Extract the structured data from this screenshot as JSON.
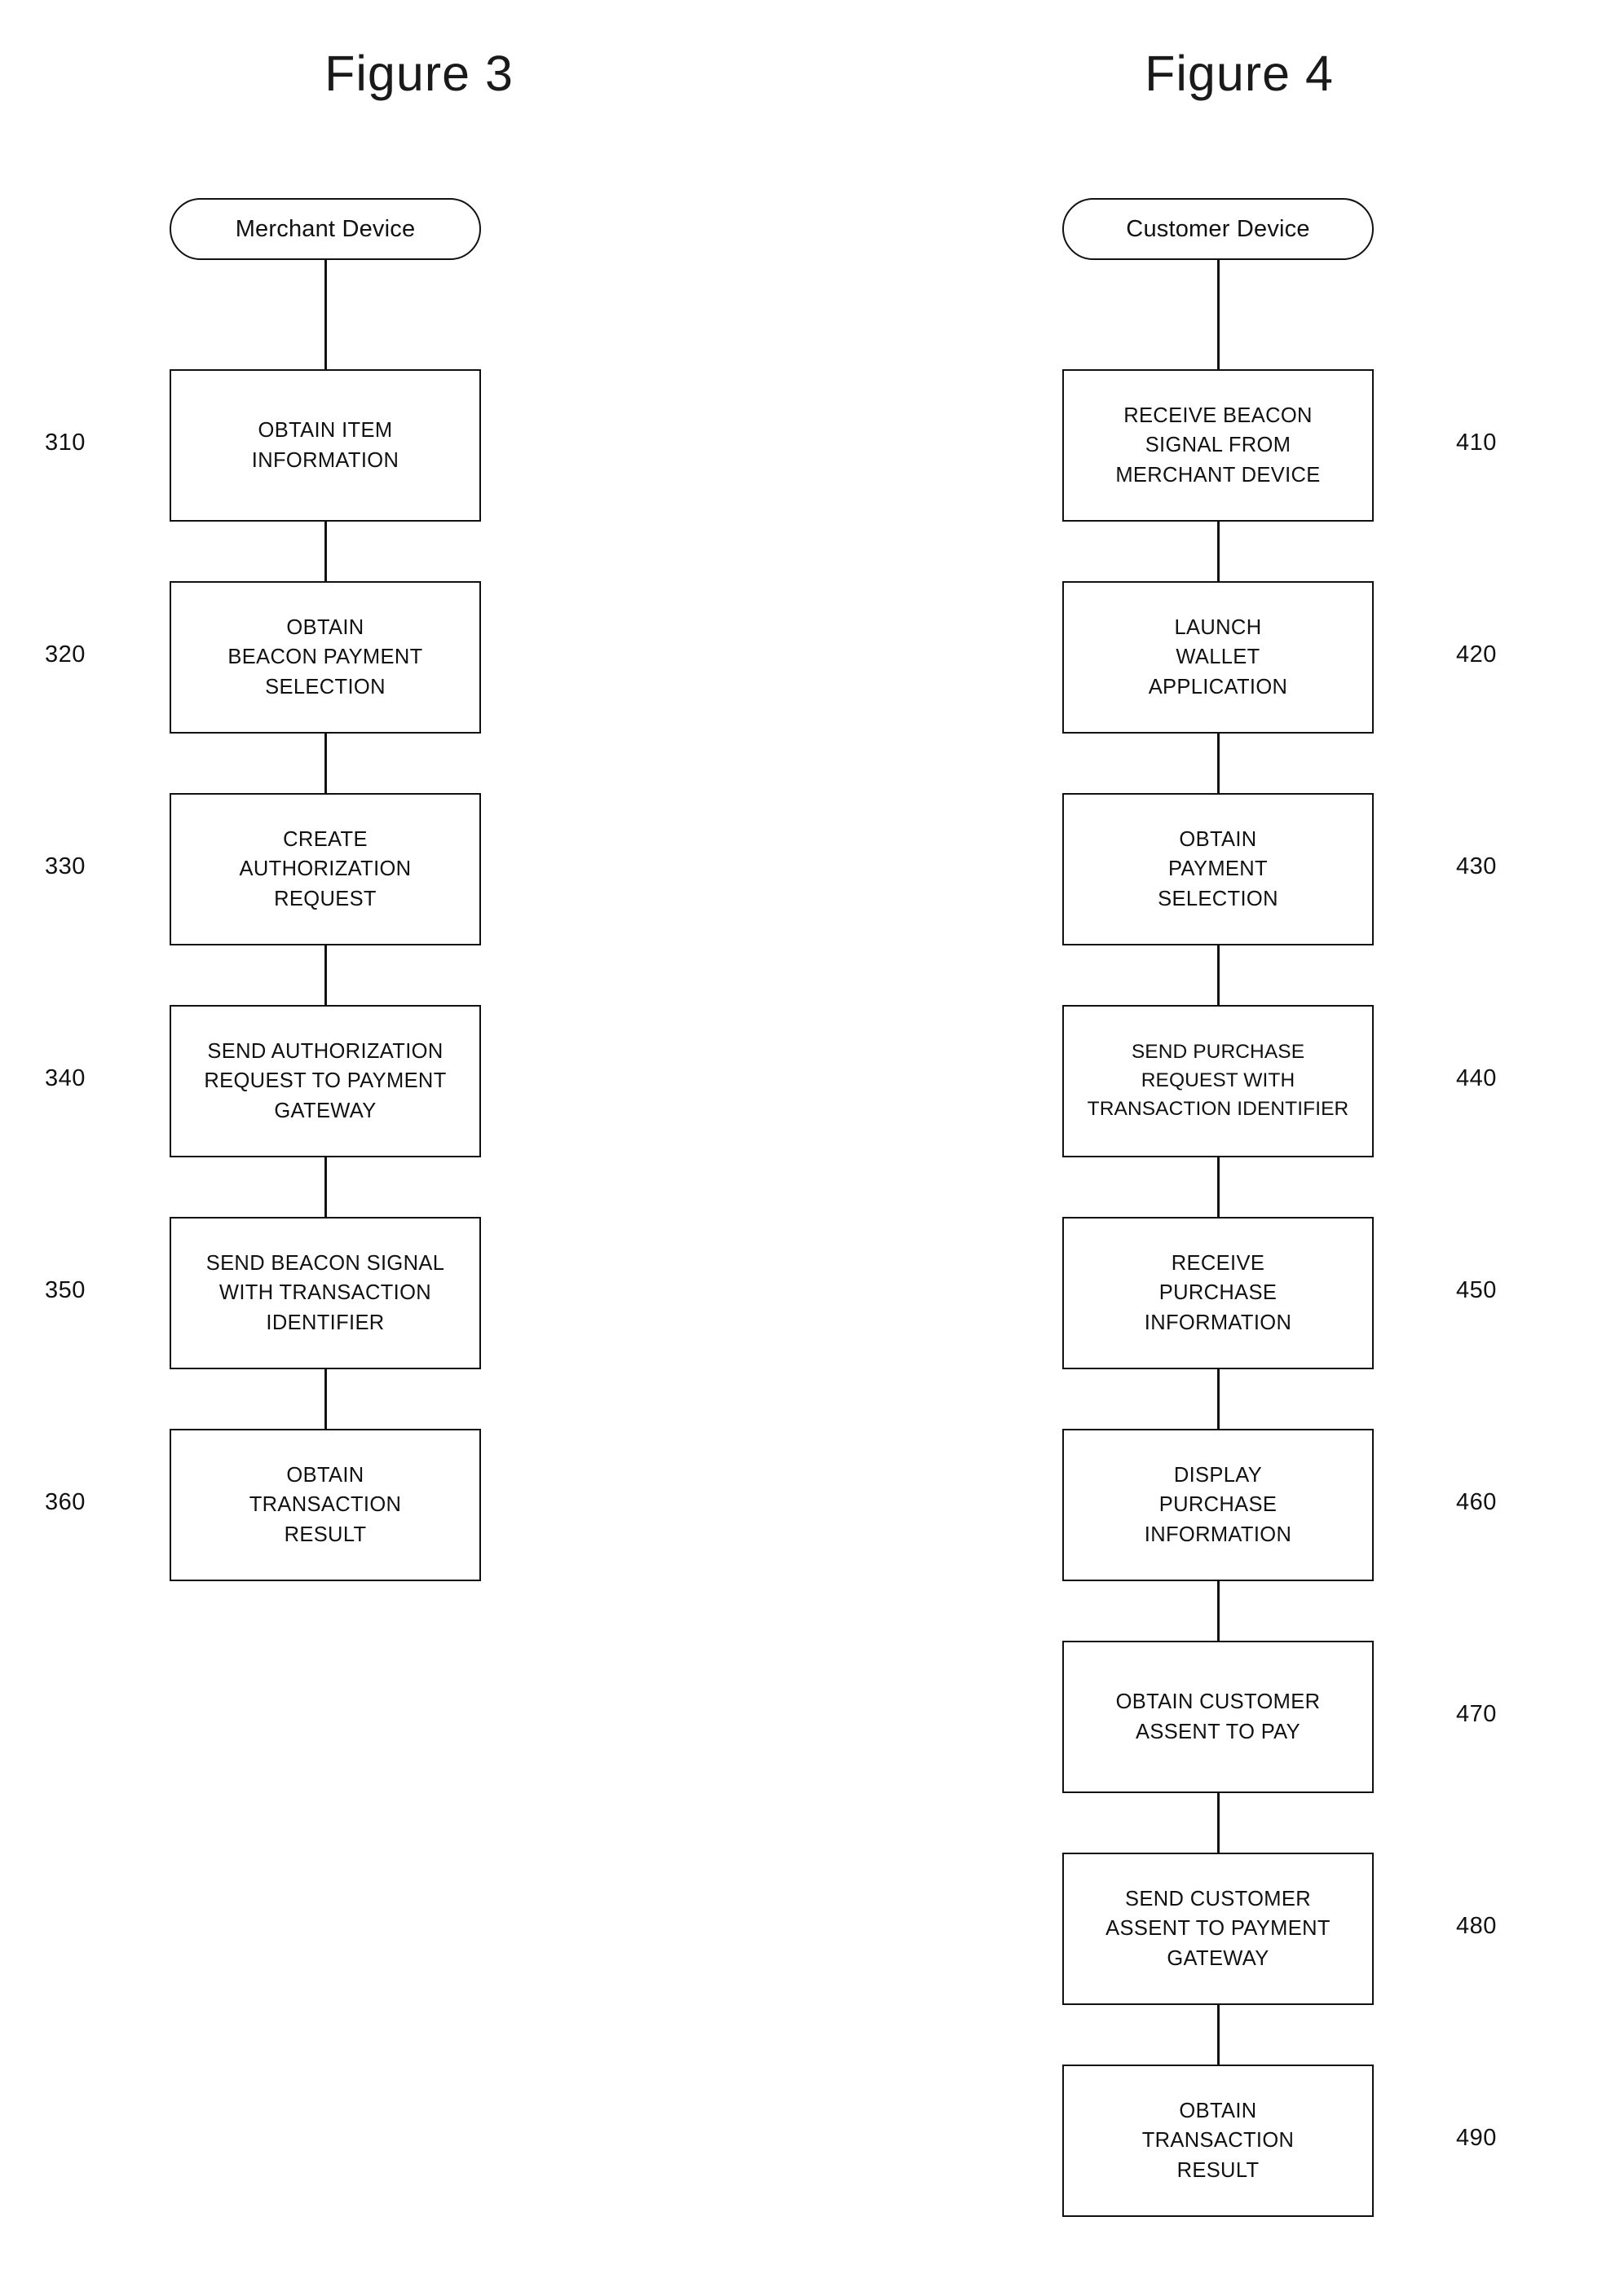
{
  "page": {
    "background_color": "#ffffff",
    "line_color": "#111111"
  },
  "figures": [
    {
      "id": "figure-3",
      "title": "Figure 3",
      "start_node": {
        "label": "Merchant Device"
      },
      "steps": [
        {
          "ref": "310",
          "lines": [
            "OBTAIN ITEM",
            "INFORMATION"
          ]
        },
        {
          "ref": "320",
          "lines": [
            "OBTAIN",
            "BEACON PAYMENT",
            "SELECTION"
          ]
        },
        {
          "ref": "330",
          "lines": [
            "CREATE",
            "AUTHORIZATION",
            "REQUEST"
          ]
        },
        {
          "ref": "340",
          "lines": [
            "SEND AUTHORIZATION",
            "REQUEST TO PAYMENT",
            "GATEWAY"
          ]
        },
        {
          "ref": "350",
          "lines": [
            "SEND BEACON SIGNAL",
            "WITH TRANSACTION",
            "IDENTIFIER"
          ]
        },
        {
          "ref": "360",
          "lines": [
            "OBTAIN",
            "TRANSACTION",
            "RESULT"
          ]
        }
      ]
    },
    {
      "id": "figure-4",
      "title": "Figure 4",
      "start_node": {
        "label": "Customer Device"
      },
      "steps": [
        {
          "ref": "410",
          "lines": [
            "RECEIVE BEACON",
            "SIGNAL FROM",
            "MERCHANT DEVICE"
          ]
        },
        {
          "ref": "420",
          "lines": [
            "LAUNCH",
            "WALLET",
            "APPLICATION"
          ]
        },
        {
          "ref": "430",
          "lines": [
            "OBTAIN",
            "PAYMENT",
            "SELECTION"
          ]
        },
        {
          "ref": "440",
          "lines": [
            "SEND PURCHASE",
            "REQUEST WITH",
            "TRANSACTION IDENTIFIER"
          ]
        },
        {
          "ref": "450",
          "lines": [
            "RECEIVE",
            "PURCHASE",
            "INFORMATION"
          ]
        },
        {
          "ref": "460",
          "lines": [
            "DISPLAY",
            "PURCHASE",
            "INFORMATION"
          ]
        },
        {
          "ref": "470",
          "lines": [
            "OBTAIN CUSTOMER",
            "ASSENT TO PAY"
          ]
        },
        {
          "ref": "480",
          "lines": [
            "SEND CUSTOMER",
            "ASSENT TO PAYMENT",
            "GATEWAY"
          ]
        },
        {
          "ref": "490",
          "lines": [
            "OBTAIN",
            "TRANSACTION",
            "RESULT"
          ]
        }
      ]
    }
  ]
}
